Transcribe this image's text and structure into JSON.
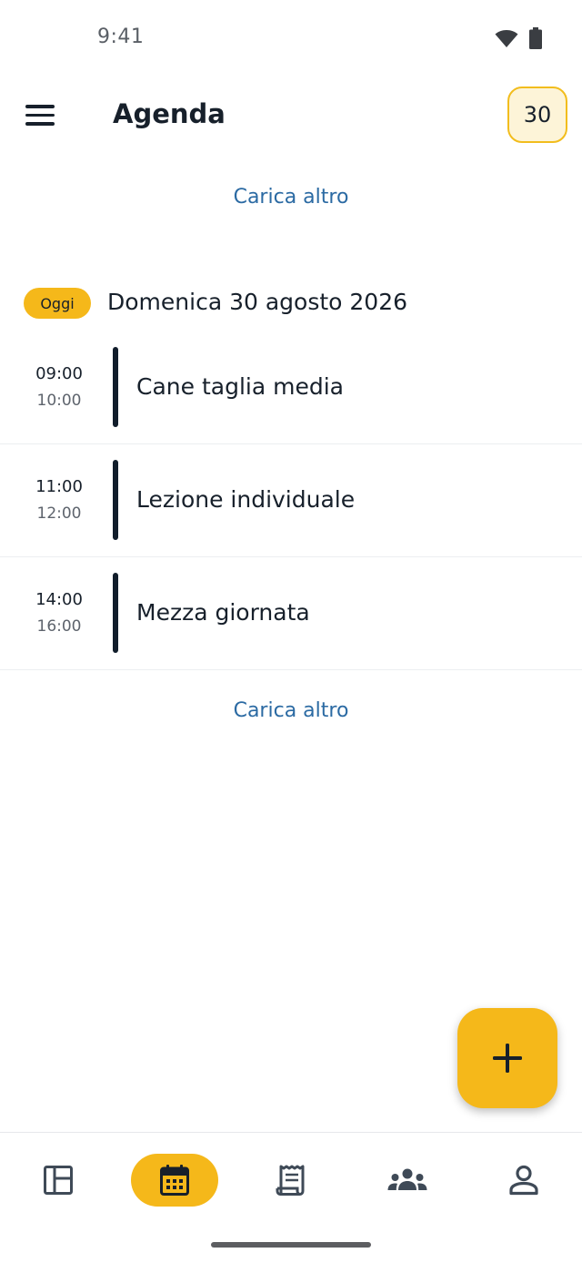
{
  "status_bar": {
    "time": "9:41",
    "icons": [
      "wifi-icon",
      "battery-icon"
    ]
  },
  "app_bar": {
    "title": "Agenda",
    "menu_icon": "menu-icon",
    "day_badge": "30"
  },
  "load_more_top": "Carica altro",
  "day": {
    "today_label": "Oggi",
    "date": "Domenica 30 agosto 2026"
  },
  "events": [
    {
      "start": "09:00",
      "end": "10:00",
      "title": "Cane taglia media"
    },
    {
      "start": "11:00",
      "end": "12:00",
      "title": "Lezione individuale"
    },
    {
      "start": "14:00",
      "end": "16:00",
      "title": "Mezza giornata"
    }
  ],
  "load_more_bottom": "Carica altro",
  "fab": {
    "icon": "plus-icon"
  },
  "bottom_nav": {
    "items": [
      {
        "icon": "dashboard-icon",
        "active": false
      },
      {
        "icon": "calendar-icon",
        "active": true
      },
      {
        "icon": "receipt-icon",
        "active": false
      },
      {
        "icon": "groups-icon",
        "active": false
      },
      {
        "icon": "person-icon",
        "active": false
      }
    ]
  },
  "colors": {
    "accent": "#f5b81a",
    "link": "#2b6aa3",
    "text": "#17202b",
    "badge_bg": "#fdf4d8"
  }
}
